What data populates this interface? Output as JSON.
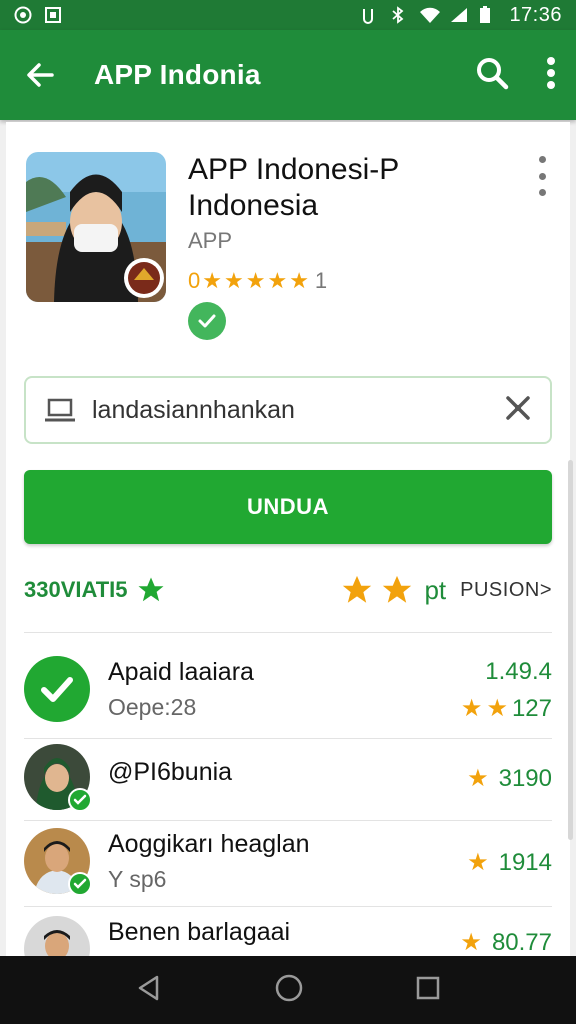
{
  "status_bar": {
    "time": "17:36"
  },
  "app_bar": {
    "title": "APP Indonia"
  },
  "app": {
    "name": "APP Indonesi-P Indonesia",
    "developer": "APP",
    "rating_prefix": "0",
    "rating_stars": 5,
    "rating_suffix": "1"
  },
  "search": {
    "value": "landasiannhankan"
  },
  "install_label": "UNDUA",
  "meta": {
    "left_label": "330VIATI5",
    "right_pt": "pt",
    "right_more": "PUSION>"
  },
  "colors": {
    "primary": "#1f8c3a",
    "button": "#21a832",
    "star": "#f2a20c"
  },
  "list": [
    {
      "name": "Apaid laaiara",
      "sub": "Oepe:28",
      "top_value": "1.49.4",
      "bottom_value": "127",
      "stars": 2
    },
    {
      "name": "@PI6bunia",
      "sub": "",
      "value": "3190",
      "stars": 1
    },
    {
      "name": "Aoggikarı heaglan",
      "sub": "Y sp6",
      "value": "1914",
      "stars": 1
    },
    {
      "name": "Benen barlagaai",
      "sub": "",
      "value": "80.77",
      "stars": 1
    }
  ]
}
